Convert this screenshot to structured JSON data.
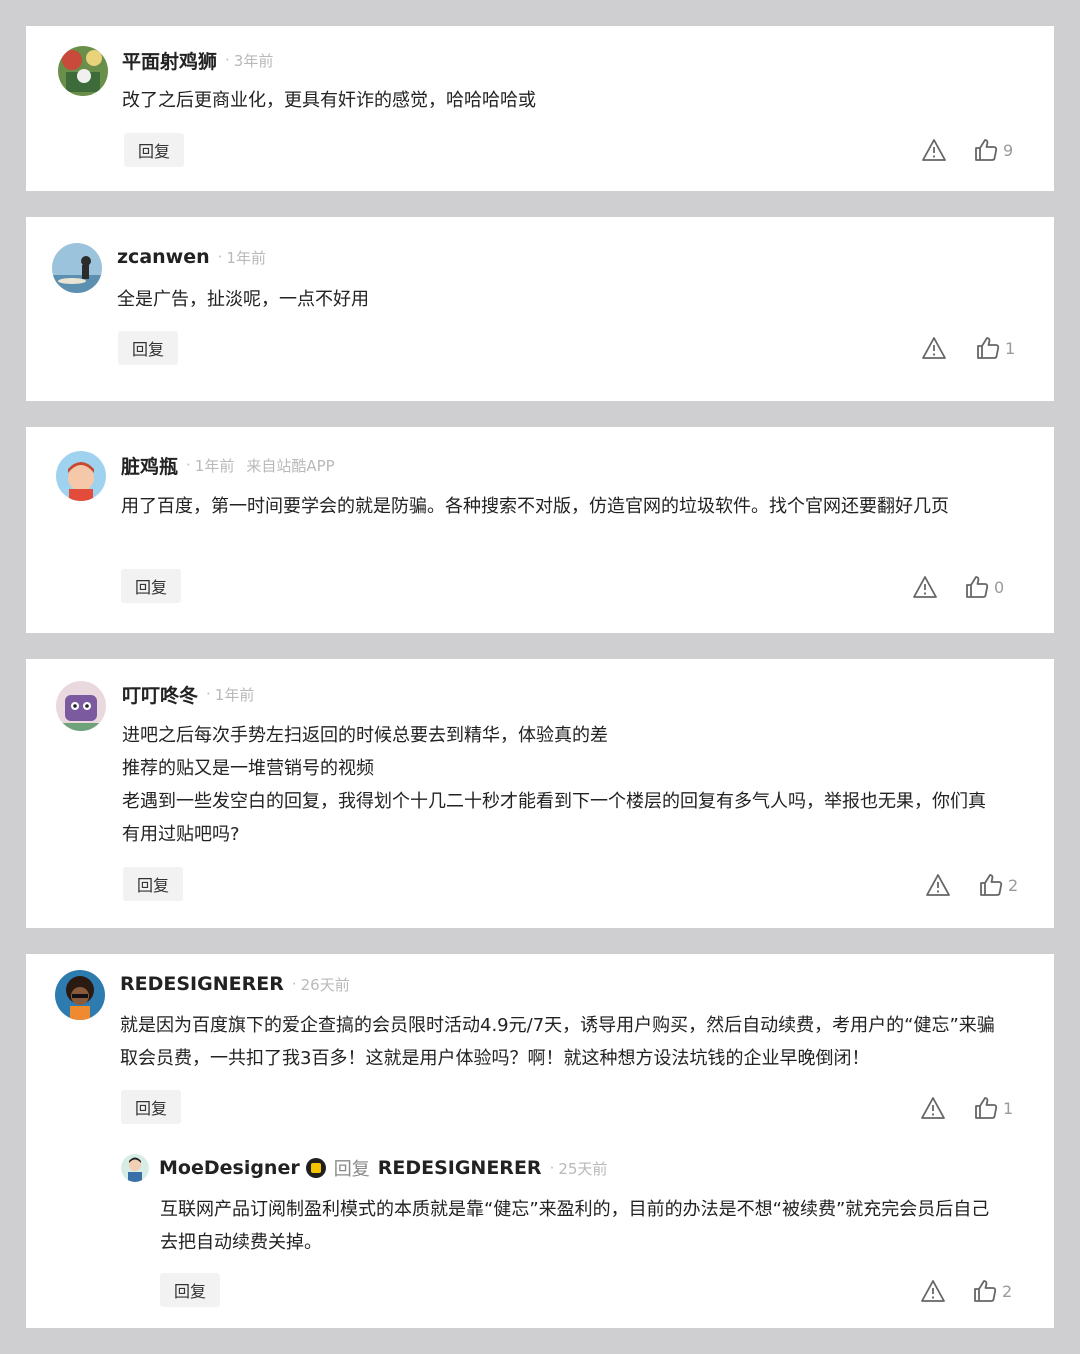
{
  "comments": [
    {
      "username": "平面射鸡狮",
      "time": "3年前",
      "source": "",
      "content": [
        "改了之后更商业化，更具有奸诈的感觉，哈哈哈哈或"
      ],
      "reply_label": "回复",
      "likes": "9",
      "avatar_icon": "avatar-photo"
    },
    {
      "username": "zcanwen",
      "time": "1年前",
      "source": "",
      "content": [
        "全是广告，扯淡呢，一点不好用"
      ],
      "reply_label": "回复",
      "likes": "1",
      "avatar_icon": "avatar-photo"
    },
    {
      "username": "脏鸡瓶",
      "time": "1年前",
      "source": "来自站酷APP",
      "content": [
        "用了百度，第一时间要学会的就是防骗。各种搜索不对版，仿造官网的垃圾软件。找个官网还要翻好几页"
      ],
      "reply_label": "回复",
      "likes": "0",
      "avatar_icon": "avatar-cartoon"
    },
    {
      "username": "叮叮咚冬",
      "time": "1年前",
      "source": "",
      "content": [
        "进吧之后每次手势左扫返回的时候总要去到精华，体验真的差",
        "推荐的贴又是一堆营销号的视频",
        "老遇到一些发空白的回复，我得划个十几二十秒才能看到下一个楼层的回复有多气人吗，举报也无果，你们真有用过贴吧吗?"
      ],
      "reply_label": "回复",
      "likes": "2",
      "avatar_icon": "avatar-cartoon"
    },
    {
      "username": "REDESIGNERER",
      "time": "26天前",
      "source": "",
      "content": [
        "就是因为百度旗下的爱企查搞的会员限时活动4.9元/7天，诱导用户购买，然后自动续费，考用户的“健忘”来骗取会员费，一共扣了我3百多！这就是用户体验吗？啊！就这种想方设法坑钱的企业早晚倒闭！"
      ],
      "reply_label": "回复",
      "likes": "1",
      "avatar_icon": "avatar-photo",
      "reply": {
        "username": "MoeDesigner",
        "reply_word": "回复",
        "reply_to": "REDESIGNERER",
        "time": "25天前",
        "content": [
          "互联网产品订阅制盈利模式的本质就是靠“健忘”来盈利的，目前的办法是不想“被续费”就充完会员后自己去把自动续费关掉。"
        ],
        "reply_label": "回复",
        "likes": "2",
        "avatar_icon": "avatar-cartoon",
        "badge_icon": "verified-badge-icon"
      }
    }
  ],
  "separator": "·",
  "colors": {
    "background": "#cfcfd1",
    "card": "#ffffff",
    "muted": "#b9b9b9",
    "reply_bg": "#f2f2f2",
    "badge": "#f5c400"
  }
}
